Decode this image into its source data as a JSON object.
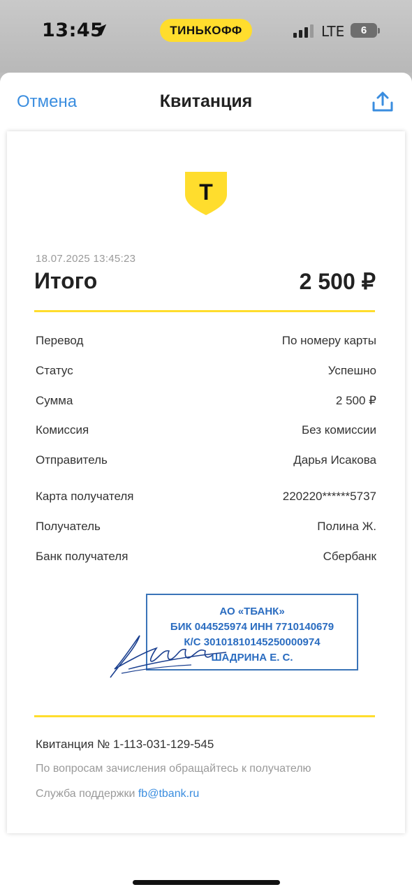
{
  "status_bar": {
    "time": "13:45",
    "brand": "ТИНЬКОФФ",
    "network": "LTE",
    "battery": "6",
    "brand_color": "#ffdd2d"
  },
  "nav": {
    "cancel_label": "Отмена",
    "title": "Квитанция",
    "share_icon": "share-icon"
  },
  "receipt": {
    "logo_letter": "Т",
    "datetime": "18.07.2025  13:45:23",
    "total_label": "Итого",
    "total_value": "2 500 ₽",
    "rows": [
      {
        "label": "Перевод",
        "value": "По номеру карты"
      },
      {
        "label": "Статус",
        "value": "Успешно"
      },
      {
        "label": "Сумма",
        "value": "2 500 ₽"
      },
      {
        "label": "Комиссия",
        "value": "Без комиссии"
      },
      {
        "label": "Отправитель",
        "value": "Дарья Исакова"
      },
      {
        "label": "Карта получателя",
        "value": "220220******5737"
      },
      {
        "label": "Получатель",
        "value": "Полина Ж."
      },
      {
        "label": "Банк получателя",
        "value": "Сбербанк"
      }
    ],
    "stamp": {
      "line1": "АО «ТБАНК»",
      "line2": "БИК 044525974 ИНН 7710140679",
      "line3": "К/С 30101810145250000974",
      "line4": "ШАДРИНА Е. С."
    },
    "receipt_number": "Квитанция  № 1-113-031-129-545",
    "contact_note": "По вопросам зачисления обращайтесь к получателю",
    "support_label": "Служба поддержки ",
    "support_email": "fb@tbank.ru",
    "accent_color": "#ffdd2d",
    "stamp_color": "#2a6cc0"
  }
}
